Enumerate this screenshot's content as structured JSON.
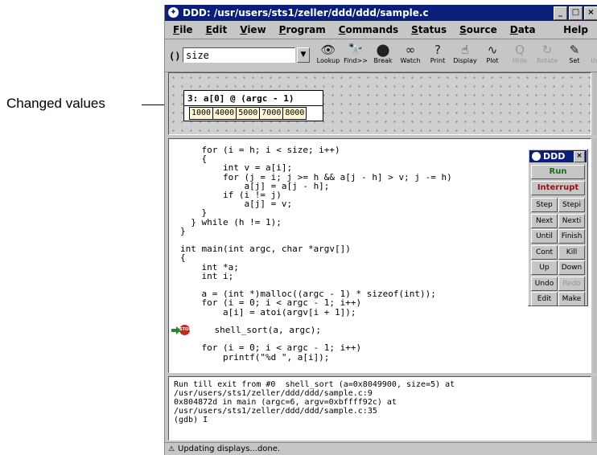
{
  "annotation": {
    "label": "Changed values"
  },
  "window": {
    "title": "DDD: /usr/users/sts1/zeller/ddd/ddd/sample.c",
    "controls": [
      "_",
      "□",
      "×"
    ]
  },
  "menubar": {
    "items": [
      {
        "u": "F",
        "rest": "ile"
      },
      {
        "u": "E",
        "rest": "dit"
      },
      {
        "u": "V",
        "rest": "iew"
      },
      {
        "u": "P",
        "rest": "rogram"
      },
      {
        "u": "C",
        "rest": "ommands"
      },
      {
        "u": "S",
        "rest": "tatus"
      },
      {
        "u": "S",
        "rest": "ource"
      },
      {
        "u": "D",
        "rest": "ata"
      }
    ],
    "help": "Help"
  },
  "toolbar": {
    "arg_label": "():",
    "arg_value": "size",
    "buttons": [
      {
        "label": "Lookup",
        "icon": "binoculars-icon",
        "glyph": "👁",
        "enabled": true
      },
      {
        "label": "Find>>",
        "icon": "find-icon",
        "glyph": "🔭",
        "enabled": true
      },
      {
        "label": "Break",
        "icon": "stop-sign-icon",
        "glyph": "⬤",
        "enabled": true
      },
      {
        "label": "Watch",
        "icon": "glasses-icon",
        "glyph": "∞",
        "enabled": true
      },
      {
        "label": "Print",
        "icon": "question-icon",
        "glyph": "?",
        "enabled": true
      },
      {
        "label": "Display",
        "icon": "hand-icon",
        "glyph": "☝",
        "enabled": true
      },
      {
        "label": "Plot",
        "icon": "plot-icon",
        "glyph": "∿",
        "enabled": true
      },
      {
        "label": "Hide",
        "icon": "hide-icon",
        "glyph": "Q",
        "enabled": false
      },
      {
        "label": "Rotate",
        "icon": "rotate-icon",
        "glyph": "↻",
        "enabled": false
      },
      {
        "label": "Set",
        "icon": "set-icon",
        "glyph": "✎",
        "enabled": true
      },
      {
        "label": "Undisp",
        "icon": "undisplay-icon",
        "glyph": "✕",
        "enabled": false
      }
    ]
  },
  "display": {
    "title": "3: a[0] @ (argc - 1)",
    "values": [
      "1000",
      "4000",
      "5000",
      "7000",
      "8000"
    ]
  },
  "source": {
    "lines": [
      "    for (i = h; i < size; i++)",
      "    {",
      "        int v = a[i];",
      "        for (j = i; j >= h && a[j - h] > v; j -= h)",
      "            a[j] = a[j - h];",
      "        if (i != j)",
      "            a[j] = v;",
      "    }",
      "  } while (h != 1);",
      "}",
      "",
      "int main(int argc, char *argv[])",
      "{",
      "    int *a;",
      "    int i;",
      "",
      "    a = (int *)malloc((argc - 1) * sizeof(int));",
      "    for (i = 0; i < argc - 1; i++)",
      "        a[i] = atoi(argv[i + 1]);",
      "",
      "    shell_sort(a, argc);",
      "",
      "    for (i = 0; i < argc - 1; i++)",
      "        printf(\"%d \", a[i]);"
    ],
    "stop_label": "STOP"
  },
  "command_tool": {
    "title": "DDD",
    "close": "×",
    "run": "Run",
    "interrupt": "Interrupt",
    "rows": [
      [
        "Step",
        "Stepi"
      ],
      [
        "Next",
        "Nexti"
      ],
      [
        "Until",
        "Finish"
      ],
      [
        "Cont",
        "Kill"
      ],
      [
        "Up",
        "Down"
      ],
      [
        "Undo",
        "Redo"
      ],
      [
        "Edit",
        "Make"
      ]
    ],
    "disabled": [
      "Redo"
    ]
  },
  "console": {
    "lines": [
      "Run till exit from #0  shell_sort (a=0x8049900, size=5) at",
      "/usr/users/sts1/zeller/ddd/ddd/sample.c:9",
      "0x804872d in main (argc=6, argv=0xbffff92c) at",
      "/usr/users/sts1/zeller/ddd/ddd/sample.c:35",
      "(gdb) I"
    ]
  },
  "status": {
    "icon": "warning-triangle-icon",
    "glyph": "⚠",
    "text": "Updating displays...done."
  },
  "colors": {
    "titlebar": "#0a1f7a",
    "stop_red": "#c62a1e",
    "exec_arrow_green": "#1c8c2c",
    "run_green": "#1a6e1a",
    "interrupt_red": "#a01010",
    "value_cell_bg": "#fff6d4"
  }
}
